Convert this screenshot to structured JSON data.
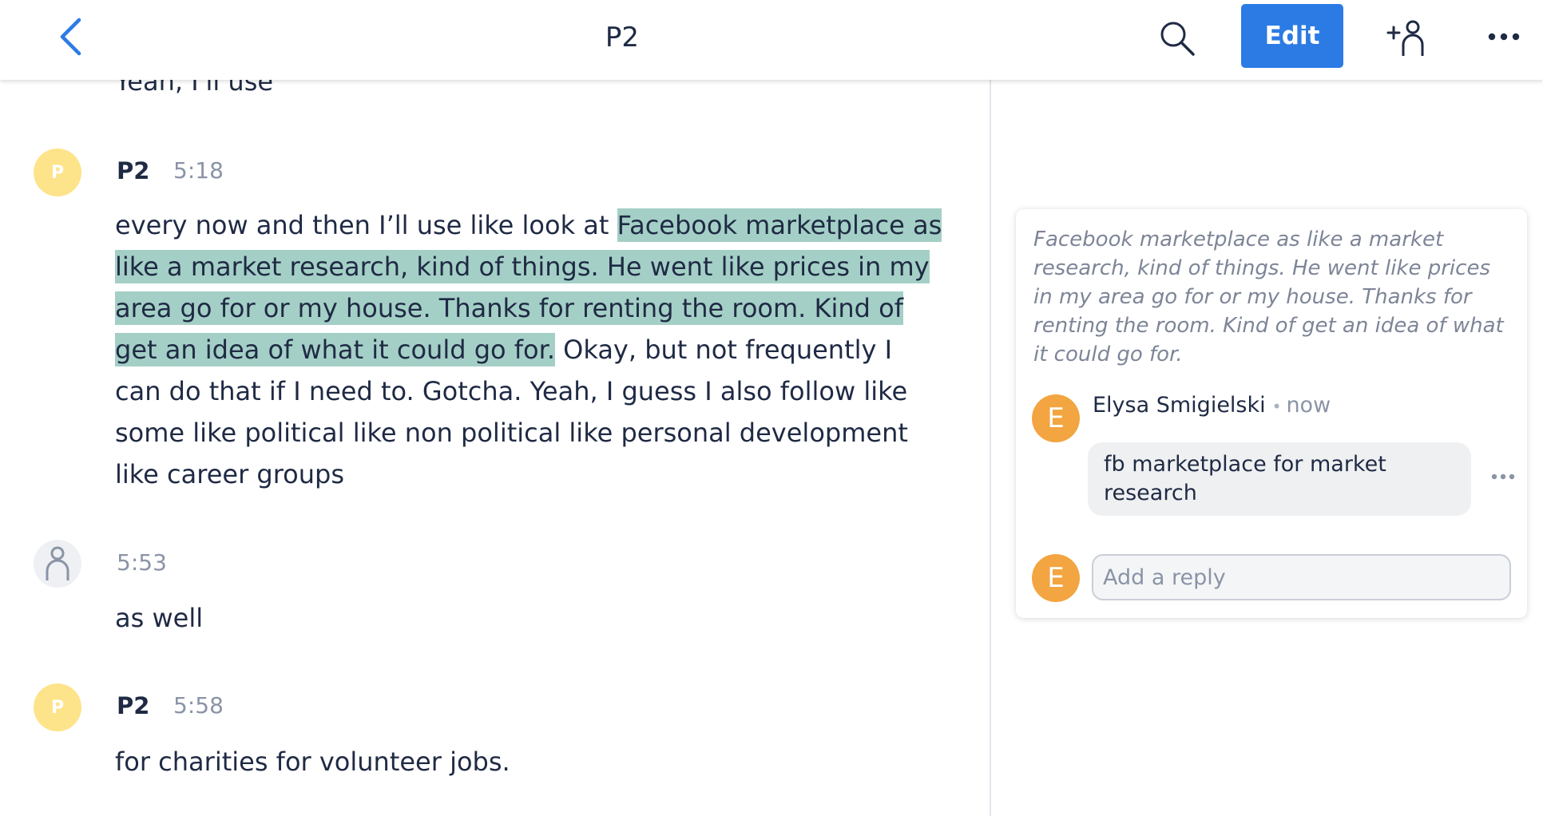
{
  "header": {
    "title": "P2",
    "edit_label": "Edit"
  },
  "transcript": {
    "cut_text": "Yeah, I'll use",
    "blocks": [
      {
        "avatar_letter": "P",
        "speaker": "P2",
        "time": "5:18",
        "text_before": "every now and then I’ll use like look at ",
        "highlight": "Facebook marketplace as like a market research, kind of things. He went like prices in my area go for or my house. Thanks for renting the room. Kind of get an idea of what it could go for.",
        "text_after": " Okay, but not frequently I can do that if I need to. Gotcha. Yeah, I guess I also follow like some like political like non political like personal development like career groups"
      },
      {
        "avatar_icon": "person-icon",
        "speaker": "",
        "time": "5:53",
        "text": "as well"
      },
      {
        "avatar_letter": "P",
        "speaker": "P2",
        "time": "5:58",
        "text": "for charities for volunteer jobs."
      }
    ]
  },
  "comment": {
    "quote": "Facebook marketplace as like a market research, kind of things. He went like prices in my area go for or my house. Thanks for renting the room. Kind of get an idea of what it could go for.",
    "author_initial": "E",
    "author": "Elysa Smigielski",
    "separator": "•",
    "time": "now",
    "body": "fb marketplace for market research",
    "reply_initial": "E",
    "reply_placeholder": "Add a reply"
  },
  "colors": {
    "accent": "#2c7be5",
    "highlight": "#a4cfc6",
    "speaker_avatar": "#fde48a",
    "commenter_avatar": "#f2a540"
  }
}
